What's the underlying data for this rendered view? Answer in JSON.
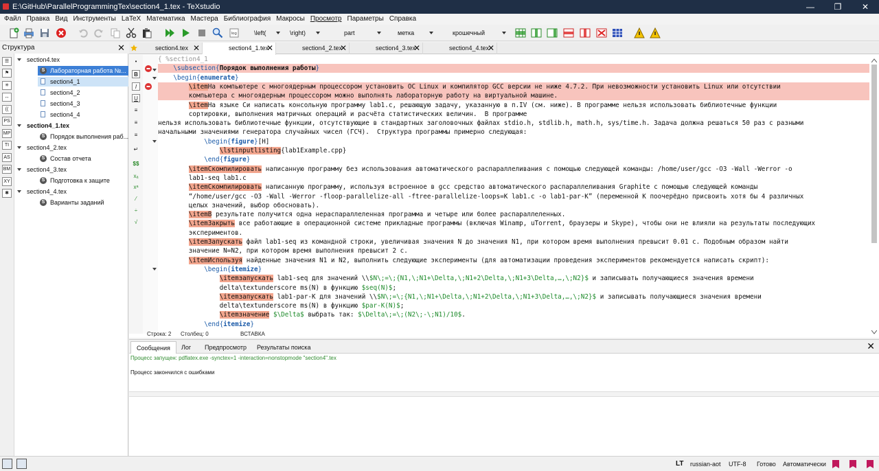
{
  "window": {
    "title": "E:\\GitHub\\ParallelProgrammingTex\\section4_1.tex - TeXstudio"
  },
  "menu": [
    "Файл",
    "Правка",
    "Вид",
    "Инструменты",
    "LaTeX",
    "Математика",
    "Мастера",
    "Библиография",
    "Макросы",
    "Просмотр",
    "Параметры",
    "Справка"
  ],
  "toolbar": {
    "combo_left": "\\left(",
    "combo_right": "\\right)",
    "combo_part": "part",
    "combo_label": "метка",
    "combo_size": "крошечный"
  },
  "structure": {
    "title": "Структура",
    "side_icons": [
      "MP",
      "TI",
      "AS",
      "BM",
      "XY",
      "PS"
    ],
    "items": [
      {
        "label": "section4.tex",
        "level": 0,
        "type": "file"
      },
      {
        "label": "Лабораторная работа №...",
        "level": 1,
        "type": "section",
        "selected": true
      },
      {
        "label": "section4_1",
        "level": 1,
        "type": "include",
        "selected_light": true
      },
      {
        "label": "section4_2",
        "level": 1,
        "type": "include"
      },
      {
        "label": "section4_3",
        "level": 1,
        "type": "include"
      },
      {
        "label": "section4_4",
        "level": 1,
        "type": "include"
      },
      {
        "label": "section4_1.tex",
        "level": 0,
        "type": "file",
        "bold": true
      },
      {
        "label": "Порядок выполнения раб...",
        "level": 1,
        "type": "section"
      },
      {
        "label": "section4_2.tex",
        "level": 0,
        "type": "file"
      },
      {
        "label": "Состав отчета",
        "level": 1,
        "type": "section"
      },
      {
        "label": "section4_3.tex",
        "level": 0,
        "type": "file"
      },
      {
        "label": "Подготовка к защите",
        "level": 1,
        "type": "section"
      },
      {
        "label": "section4_4.tex",
        "level": 0,
        "type": "file"
      },
      {
        "label": "Варианты заданий",
        "level": 1,
        "type": "section"
      }
    ]
  },
  "tabs": [
    {
      "label": "section4.tex",
      "active": false
    },
    {
      "label": "section4_1.tex",
      "active": true
    },
    {
      "label": "section4_2.tex",
      "active": false
    },
    {
      "label": "section4_3.tex",
      "active": false
    },
    {
      "label": "section4_4.tex",
      "active": false
    }
  ],
  "code_lines": [
    {
      "indent": 0,
      "err": false,
      "parts": [
        [
          "cm",
          "{ %section4_1"
        ]
      ]
    },
    {
      "indent": 2,
      "err": true,
      "parts": [
        [
          "kw",
          "\\subsection"
        ],
        [
          "kw",
          "{"
        ],
        [
          "bld",
          "Порядок выполнения работы"
        ],
        [
          "kw",
          "}"
        ]
      ]
    },
    {
      "indent": 2,
      "err": false,
      "parts": [
        [
          "kw",
          "\\begin"
        ],
        [
          "kw",
          "{"
        ],
        [
          "kwb",
          "enumerate"
        ],
        [
          "kw",
          "}"
        ]
      ]
    },
    {
      "indent": 4,
      "err": true,
      "parts": [
        [
          "item",
          "\\item"
        ],
        [
          "",
          "На компьютере с многоядерным процессором установить ОС Linux и компилятор GCC версии не ниже 4.7.2. При невозможности установить Linux или отсутствии"
        ]
      ]
    },
    {
      "indent": 4,
      "err": true,
      "parts": [
        [
          "",
          "компьютера с многоядерным процессором можно выполнять лабораторную работу на виртуальной машине."
        ]
      ]
    },
    {
      "indent": 4,
      "err": false,
      "parts": [
        [
          "item",
          "\\item"
        ],
        [
          "",
          "На языке Си написать консольную программу lab1.c, решающую задачу, указанную в п.IV (см. ниже). В программе нельзя использовать библиотечные функции"
        ]
      ]
    },
    {
      "indent": 4,
      "err": false,
      "parts": [
        [
          "",
          "сортировки, выполнения матричных операций и расчёта статистических величин.  В программе"
        ]
      ]
    },
    {
      "indent": 0,
      "err": false,
      "parts": [
        [
          "",
          "нельзя использовать библиотечные функции, отсутствующие в стандартных заголовочных файлах stdio.h, stdlib.h, math.h, sys/time.h. Задача должна решаться 50 раз с разными"
        ]
      ]
    },
    {
      "indent": 0,
      "err": false,
      "parts": [
        [
          "",
          "начальными значениями генератора случайных чисел (ГСЧ).  Структура программы примерно следующая:"
        ]
      ]
    },
    {
      "indent": 6,
      "err": false,
      "parts": [
        [
          "kw",
          "\\begin"
        ],
        [
          "kw",
          "{"
        ],
        [
          "kwb",
          "figure"
        ],
        [
          "kw",
          "}"
        ],
        [
          "",
          "[H]"
        ]
      ]
    },
    {
      "indent": 8,
      "err": false,
      "parts": [
        [
          "item",
          "\\lstinputlisting"
        ],
        [
          "",
          "{lab1Example.cpp}"
        ]
      ]
    },
    {
      "indent": 6,
      "err": false,
      "parts": [
        [
          "kw",
          "\\end"
        ],
        [
          "kw",
          "{"
        ],
        [
          "kwb",
          "figure"
        ],
        [
          "kw",
          "}"
        ]
      ]
    },
    {
      "indent": 4,
      "err": false,
      "parts": [
        [
          "item",
          "\\itemСкомпилировать"
        ],
        [
          "",
          " написанную программу без использования автоматического распараллеливания с помощью следующей команды: /home/user/gcc -O3 -Wall -Werror -o"
        ]
      ]
    },
    {
      "indent": 4,
      "err": false,
      "parts": [
        [
          "",
          "lab1-seq lab1.c"
        ]
      ]
    },
    {
      "indent": 4,
      "err": false,
      "parts": [
        [
          "item",
          "\\itemСкомпилировать"
        ],
        [
          "",
          " написанную программу, используя встроенное в gcc средство автоматического распараллеливания Graphite с помощью следующей команды"
        ]
      ]
    },
    {
      "indent": 4,
      "err": false,
      "parts": [
        [
          "",
          "“/home/user/gcc -O3 -Wall -Werror -floop-parallelize-all -ftree-parallelize-loops=K lab1.c -o lab1-par-K” (переменной K поочерёдно присвоить хотя бы 4 различных"
        ]
      ]
    },
    {
      "indent": 4,
      "err": false,
      "parts": [
        [
          "",
          "целых значений, выбор обосновать)."
        ]
      ]
    },
    {
      "indent": 4,
      "err": false,
      "parts": [
        [
          "item",
          "\\itemВ"
        ],
        [
          "",
          " результате получится одна нераспараллеленная программа и четыре или более распараллеленных."
        ]
      ]
    },
    {
      "indent": 4,
      "err": false,
      "parts": [
        [
          "item",
          "\\itemЗакрыть"
        ],
        [
          "",
          " все работающие в операционной системе прикладные программы (включая Winamp, uTorrent, браузеры и Skype), чтобы они не влияли на результаты последующих"
        ]
      ]
    },
    {
      "indent": 4,
      "err": false,
      "parts": [
        [
          "",
          "экспериментов."
        ]
      ]
    },
    {
      "indent": 4,
      "err": false,
      "parts": [
        [
          "item",
          "\\itemЗапускать"
        ],
        [
          "",
          " файл lab1-seq из командной строки, увеличивая значения N до значения N1, при котором время выполнения превысит 0.01 с. Подобным образом найти"
        ]
      ]
    },
    {
      "indent": 4,
      "err": false,
      "parts": [
        [
          "",
          "значение N=N2, при котором время выполнения превысит 2 с."
        ]
      ]
    },
    {
      "indent": 4,
      "err": false,
      "parts": [
        [
          "item",
          "\\itemИспользуя"
        ],
        [
          "",
          " найденные значения N1 и N2, выполнить следующие эксперименты (для автоматизации проведения экспериментов рекомендуется написать скрипт):"
        ]
      ]
    },
    {
      "indent": 6,
      "err": false,
      "parts": [
        [
          "kw",
          "\\begin"
        ],
        [
          "kw",
          "{"
        ],
        [
          "kwb",
          "itemize"
        ],
        [
          "kw",
          "}"
        ]
      ]
    },
    {
      "indent": 8,
      "err": false,
      "parts": [
        [
          "item",
          "\\itemзапускать"
        ],
        [
          "",
          " lab1-seq для значений \\\\"
        ],
        [
          "math",
          "$N\\;=\\;{N1,\\;N1+\\Delta,\\;N1+2\\Delta,\\;N1+3\\Delta,…,\\;N2}$"
        ],
        [
          "",
          " и записывать получающиеся значения времени"
        ]
      ]
    },
    {
      "indent": 8,
      "err": false,
      "parts": [
        [
          "",
          "delta\\textunderscore ms(N) в функцию "
        ],
        [
          "math",
          "$seq(N)$"
        ],
        [
          "",
          ";"
        ]
      ]
    },
    {
      "indent": 8,
      "err": false,
      "parts": [
        [
          "item",
          "\\itemзапускать"
        ],
        [
          "",
          " lab1-par-K для значений \\\\"
        ],
        [
          "math",
          "$N\\;=\\;{N1,\\;N1+\\Delta,\\;N1+2\\Delta,\\;N1+3\\Delta,…,\\;N2}$"
        ],
        [
          "",
          " и записывать получающиеся значения времени"
        ]
      ]
    },
    {
      "indent": 8,
      "err": false,
      "parts": [
        [
          "",
          "delta\\textunderscore ms(N) в функцию "
        ],
        [
          "math",
          "$par-K(N)$"
        ],
        [
          "",
          ";"
        ]
      ]
    },
    {
      "indent": 8,
      "err": false,
      "parts": [
        [
          "item",
          "\\itemзначение"
        ],
        [
          "",
          " "
        ],
        [
          "math",
          "$\\Delta$"
        ],
        [
          "",
          " выбрать так: "
        ],
        [
          "math",
          "$\\Delta\\;=\\;(N2\\;-\\;N1)/10$"
        ],
        [
          "",
          "."
        ]
      ]
    },
    {
      "indent": 6,
      "err": false,
      "parts": [
        [
          "kw",
          "\\end"
        ],
        [
          "kw",
          "{"
        ],
        [
          "kwb",
          "itemize"
        ],
        [
          "kw",
          "}"
        ]
      ]
    }
  ],
  "cursor": {
    "line_label": "Строка: 2",
    "col_label": "Столбец: 0",
    "mode": "ВСТАВКА"
  },
  "messages": {
    "tabs": [
      "Сообщения",
      "Лог",
      "Предпросмотр",
      "Результаты поиска"
    ],
    "line1": "Процесс запущен: pdflatex.exe -synctex=1 -interaction=nonstopmode \"section4\".tex",
    "line2": "Процесс закончился с ошибками"
  },
  "statusbar": {
    "lang_icon": "LT",
    "language": "russian-aot",
    "encoding": "UTF-8",
    "ready": "Готово",
    "mode": "Автоматически"
  },
  "colors": {
    "titlebar": "#1f2f46",
    "error_line": "#f8c4bd",
    "item_highlight": "#f3a68e",
    "keyword": "#1a5aa8"
  }
}
